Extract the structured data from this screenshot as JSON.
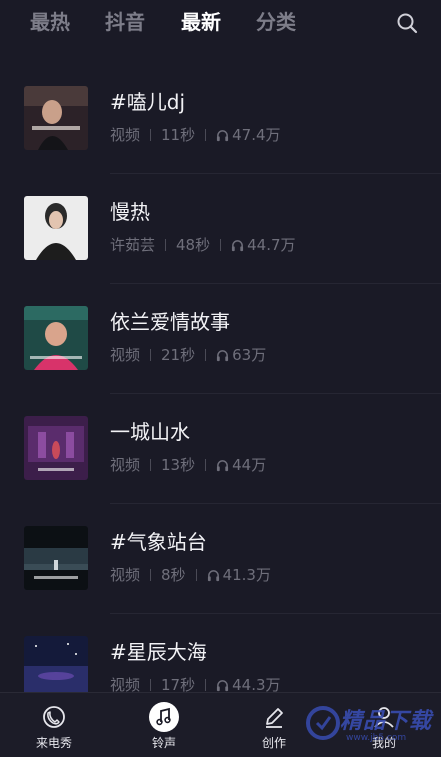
{
  "tabs": [
    {
      "label": "最热",
      "active": false
    },
    {
      "label": "抖音",
      "active": false
    },
    {
      "label": "最新",
      "active": true
    },
    {
      "label": "分类",
      "active": false
    }
  ],
  "search": {
    "icon": "search-icon"
  },
  "items": [
    {
      "title": "#嗑儿dj",
      "source": "视频",
      "duration": "11秒",
      "plays": "47.4万"
    },
    {
      "title": "慢热",
      "source": "许茹芸",
      "duration": "48秒",
      "plays": "44.7万"
    },
    {
      "title": "依兰爱情故事",
      "source": "视频",
      "duration": "21秒",
      "plays": "63万"
    },
    {
      "title": "一城山水",
      "source": "视频",
      "duration": "13秒",
      "plays": "44万"
    },
    {
      "title": "#气象站台",
      "source": "视频",
      "duration": "8秒",
      "plays": "41.3万"
    },
    {
      "title": "#星辰大海",
      "source": "视频",
      "duration": "17秒",
      "plays": "44.3万"
    }
  ],
  "bottom_nav": [
    {
      "label": "来电秀",
      "icon": "phone-icon"
    },
    {
      "label": "铃声",
      "icon": "music-note-icon"
    },
    {
      "label": "创作",
      "icon": "pen-icon"
    },
    {
      "label": "我的",
      "icon": "user-icon"
    }
  ],
  "colors": {
    "background": "#1a1a26",
    "active_tab": "#ffffff",
    "inactive_tab": "#7d7d89",
    "meta_text": "#6f6f7b"
  },
  "watermark": {
    "text": "精品下载",
    "url": "www.jb5.com"
  }
}
